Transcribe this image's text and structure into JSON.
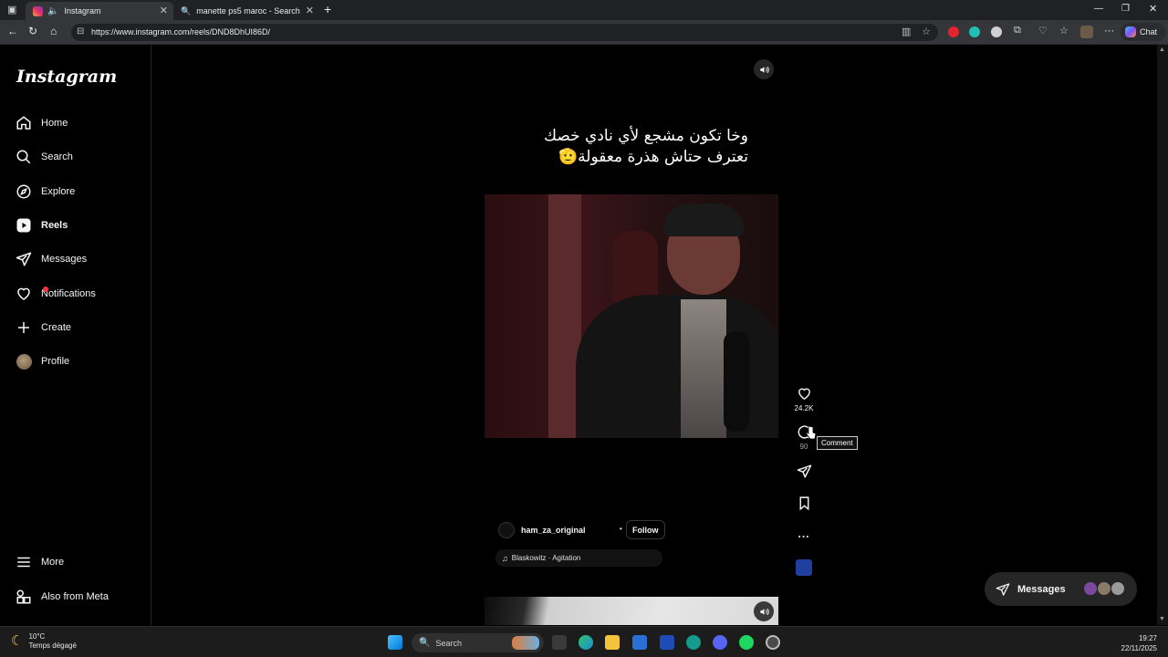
{
  "browser": {
    "tabs": [
      {
        "label": "Instagram",
        "active": true
      },
      {
        "label": "manette ps5 maroc - Search",
        "active": false
      }
    ],
    "new_tab_glyph": "+",
    "url": "https://www.instagram.com/reels/DND8DhUI86D/",
    "chat_label": "Chat",
    "window_controls": [
      "minimize-icon",
      "restore-icon",
      "close-icon"
    ]
  },
  "sidebar": {
    "logo": "Instagram",
    "items": [
      {
        "label": "Home",
        "icon": "home-icon"
      },
      {
        "label": "Search",
        "icon": "search-icon"
      },
      {
        "label": "Explore",
        "icon": "compass-icon"
      },
      {
        "label": "Reels",
        "icon": "reels-icon",
        "active": true
      },
      {
        "label": "Messages",
        "icon": "send-icon"
      },
      {
        "label": "Notifications",
        "icon": "heart-icon",
        "has_dot": true
      },
      {
        "label": "Create",
        "icon": "plus-icon"
      },
      {
        "label": "Profile",
        "icon": "avatar"
      }
    ],
    "more": "More",
    "meta": "Also from Meta"
  },
  "reel": {
    "caption_line1": "وخا تكون مشجع لأي نادي خصك",
    "caption_line2": "تعترف حتاش هذرة معقولة🫡",
    "likes": "24.2K",
    "comments": "90",
    "tooltip": "Comment",
    "more_glyph": "...",
    "author": "ham_za_original",
    "separator": "•",
    "follow": "Follow",
    "audio": "Blaskowitz · Agitation"
  },
  "messages_bar": {
    "label": "Messages"
  },
  "taskbar": {
    "weather_temp": "10°C",
    "weather_desc": "Temps dégagé",
    "search_placeholder": "Search",
    "time": "19:27",
    "date": "22/11/2025"
  },
  "colors": {
    "accent": "#ff3040",
    "background": "#000000",
    "surface": "#262626"
  }
}
